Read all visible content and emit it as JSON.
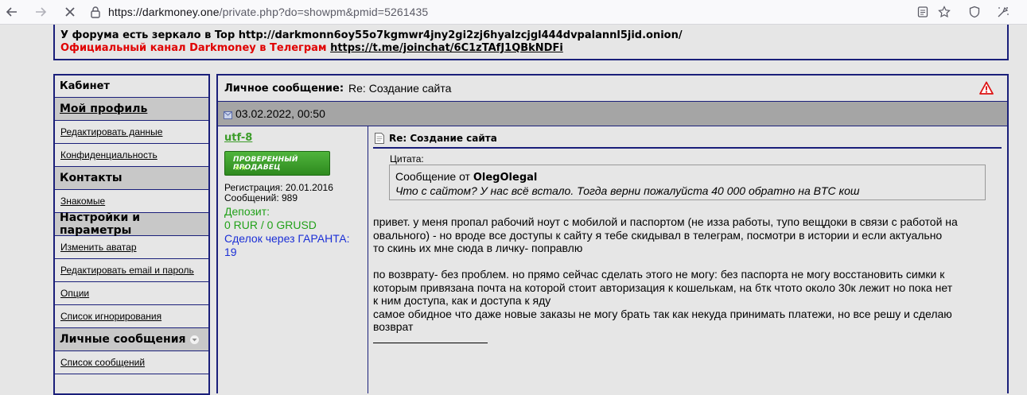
{
  "browser": {
    "url_host": "https://darkmoney.one",
    "url_path": "/private.php?do=showpm&pmid=5261435"
  },
  "announce": {
    "line1": "У форума есть зеркало в Top http://darkmonn6oy55o7kgmwr4jny2gi2zj6hyalzcjgl444dvpalannl5jid.onion/",
    "line2_red": "Официальный канал Darkmoney в Телеграм",
    "line2_link": "https://t.me/joinchat/6C1zTAfJ1QBkNDFi"
  },
  "sidebar": {
    "cabinet": "Кабинет",
    "my_profile": "Мой профиль",
    "edit_data": "Редактировать данные",
    "privacy": "Конфиденциальность",
    "contacts": "Контакты",
    "acquaintances": "Знакомые",
    "settings": "Настройки и параметры",
    "change_avatar": "Изменить аватар",
    "edit_email": "Редактировать email и пароль",
    "options": "Опции",
    "ignore_list": "Список игнорирования",
    "private_messages": "Личные сообщения",
    "message_list": "Список сообщений"
  },
  "message": {
    "title_label": "Личное сообщение:",
    "title_text": "Re: Создание сайта",
    "date": "03.02.2022, 00:50",
    "subject": "Re: Создание сайта",
    "quote_label": "Цитата:",
    "quote_from_prefix": "Сообщение от",
    "quote_author": "OlegOlegal",
    "quote_text": "Что с сайтом? У нас всё встало. Тогда верни пожалуйста 40 000 обратно на BTC кош",
    "paragraph1": [
      "привет. у меня пропал рабочий ноут с мобилой и паспортом (не изза работы, тупо вещдоки в связи с работой на",
      "овального) - но вроде все доступы к сайту я тебе скидывал в телеграм, посмотри в истории и если актуально",
      "то скинь их мне сюда в личку- поправлю"
    ],
    "paragraph2": [
      "по возврату- без проблем. но прямо сейчас сделать этого не могу: без паспорта не могу восстановить симки к",
      "которым привязана почта на которой стоит авторизация к кошелькам, на бтк чтото около 30к лежит но пока нет",
      "к ним доступа, как и доступа к яду",
      "самое обидное что даже новые заказы не могу брать так как некуда принимать платежи, но все решу и сделаю",
      "возврат"
    ]
  },
  "author": {
    "username": "utf-8",
    "badge": "ПРОВЕРЕННЫЙ ПРОДАВЕЦ",
    "registration": "Регистрация: 20.01.2016",
    "messages": "Сообщений: 989",
    "deposit_label": "Депозит:",
    "deposit_value": "0 RUR / 0 GRUSD",
    "guarantor_deals": "Сделок через ГАРАНТА: 19"
  },
  "colors": {
    "border": "#1a1f7a",
    "username": "#3c9c2a",
    "deposit": "#22a11a",
    "guarantor": "#1b2fd6",
    "red_link": "#e00000"
  }
}
